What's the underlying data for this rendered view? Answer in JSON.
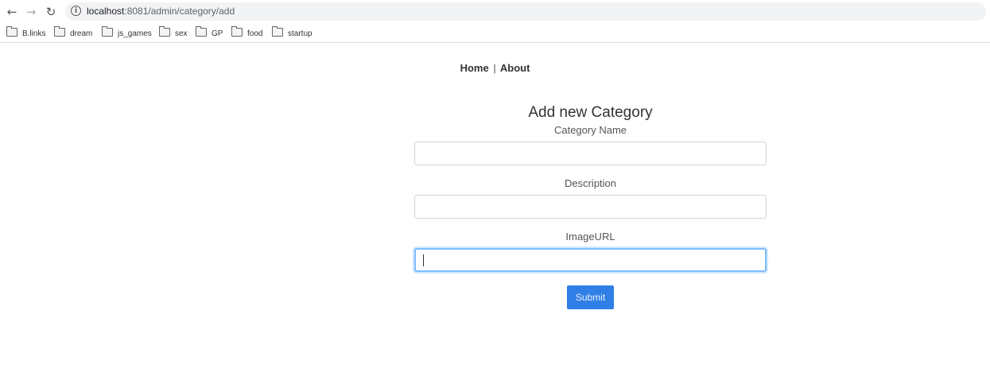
{
  "browser": {
    "url_host": "localhost",
    "url_rest": ":8081/admin/category/add",
    "bookmarks": [
      "B.links",
      "dream",
      "js_games",
      "sex",
      "GP",
      "food",
      "startup"
    ]
  },
  "nav": {
    "home": "Home",
    "separator": "|",
    "about": "About"
  },
  "form": {
    "title": "Add new Category",
    "category_name_label": "Category Name",
    "category_name_value": "",
    "description_label": "Description",
    "description_value": "",
    "image_url_label": "ImageURL",
    "image_url_value": "",
    "submit_label": "Submit"
  },
  "colors": {
    "submit_button": "#2f7fe6",
    "focus_border": "#80bdff"
  }
}
